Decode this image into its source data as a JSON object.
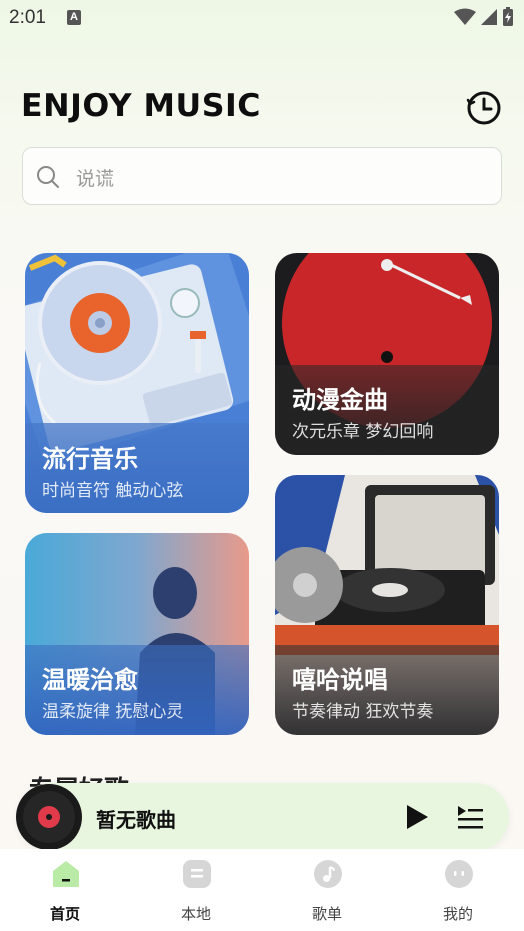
{
  "status_bar": {
    "time": "2:01"
  },
  "header": {
    "title": "ENJOY MUSIC"
  },
  "search": {
    "placeholder": "说谎"
  },
  "cards": [
    {
      "title": "流行音乐",
      "subtitle": "时尚音符 触动心弦"
    },
    {
      "title": "动漫金曲",
      "subtitle": "次元乐章 梦幻回响"
    },
    {
      "title": "温暖治愈",
      "subtitle": "温柔旋律 抚慰心灵"
    },
    {
      "title": "嘻哈说唱",
      "subtitle": "节奏律动 狂欢节奏"
    }
  ],
  "section": {
    "title": "专属好歌"
  },
  "player": {
    "song": "暂无歌曲"
  },
  "nav": [
    {
      "label": "首页",
      "active": true
    },
    {
      "label": "本地"
    },
    {
      "label": "歌单"
    },
    {
      "label": "我的"
    }
  ],
  "colors": {
    "accent_green": "#b9eaa6",
    "player_bg": "#e8f6df",
    "nav_icon": "#d6d6d6"
  }
}
